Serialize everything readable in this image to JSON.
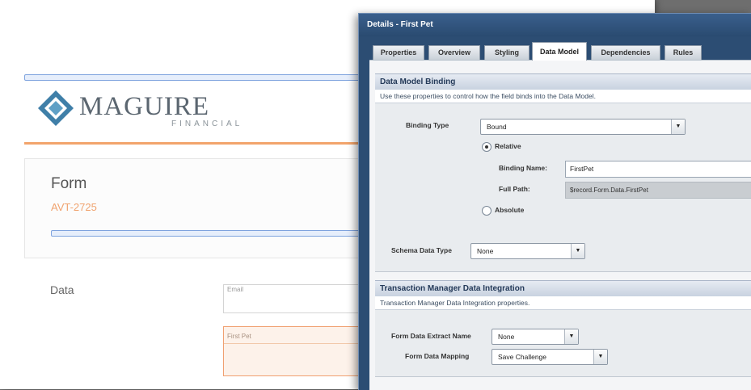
{
  "background_form": {
    "logo": {
      "wordmark": "MAGUIRE",
      "subline": "FINANCIAL"
    },
    "form_title": "Form",
    "form_code": "AVT-2725",
    "data_section_label": "Data",
    "fields": {
      "email_label": "Email",
      "first_pet_label": "First Pet"
    }
  },
  "dialog": {
    "title": "Details - First Pet",
    "tabs": [
      {
        "label": "Properties"
      },
      {
        "label": "Overview"
      },
      {
        "label": "Styling"
      },
      {
        "label": "Data Model",
        "active": true
      },
      {
        "label": "Dependencies"
      },
      {
        "label": "Rules"
      }
    ],
    "data_model_binding": {
      "heading": "Data Model Binding",
      "description": "Use these properties to control how the field binds into the Data Model.",
      "binding_type_label": "Binding Type",
      "binding_type_value": "Bound",
      "relative_label": "Relative",
      "relative_selected": true,
      "binding_name_label": "Binding Name:",
      "binding_name_value": "FirstPet",
      "full_path_label": "Full Path:",
      "full_path_value": "$record.Form.Data.FirstPet",
      "absolute_label": "Absolute",
      "absolute_selected": false,
      "schema_data_type_label": "Schema Data Type",
      "schema_data_type_value": "None"
    },
    "transaction_manager": {
      "heading": "Transaction Manager Data Integration",
      "description": "Transaction Manager Data Integration properties.",
      "extract_name_label": "Form Data Extract Name",
      "extract_name_value": "None",
      "mapping_label": "Form Data Mapping",
      "mapping_value": "Save Challenge"
    }
  },
  "colors": {
    "dialog_frame": "#2c4d73",
    "accent_orange": "#f2a46c",
    "selection_blue": "#7ea3de"
  },
  "icons": {
    "dropdown": "chevron-down-icon",
    "logo": "diamond-logo-icon"
  }
}
